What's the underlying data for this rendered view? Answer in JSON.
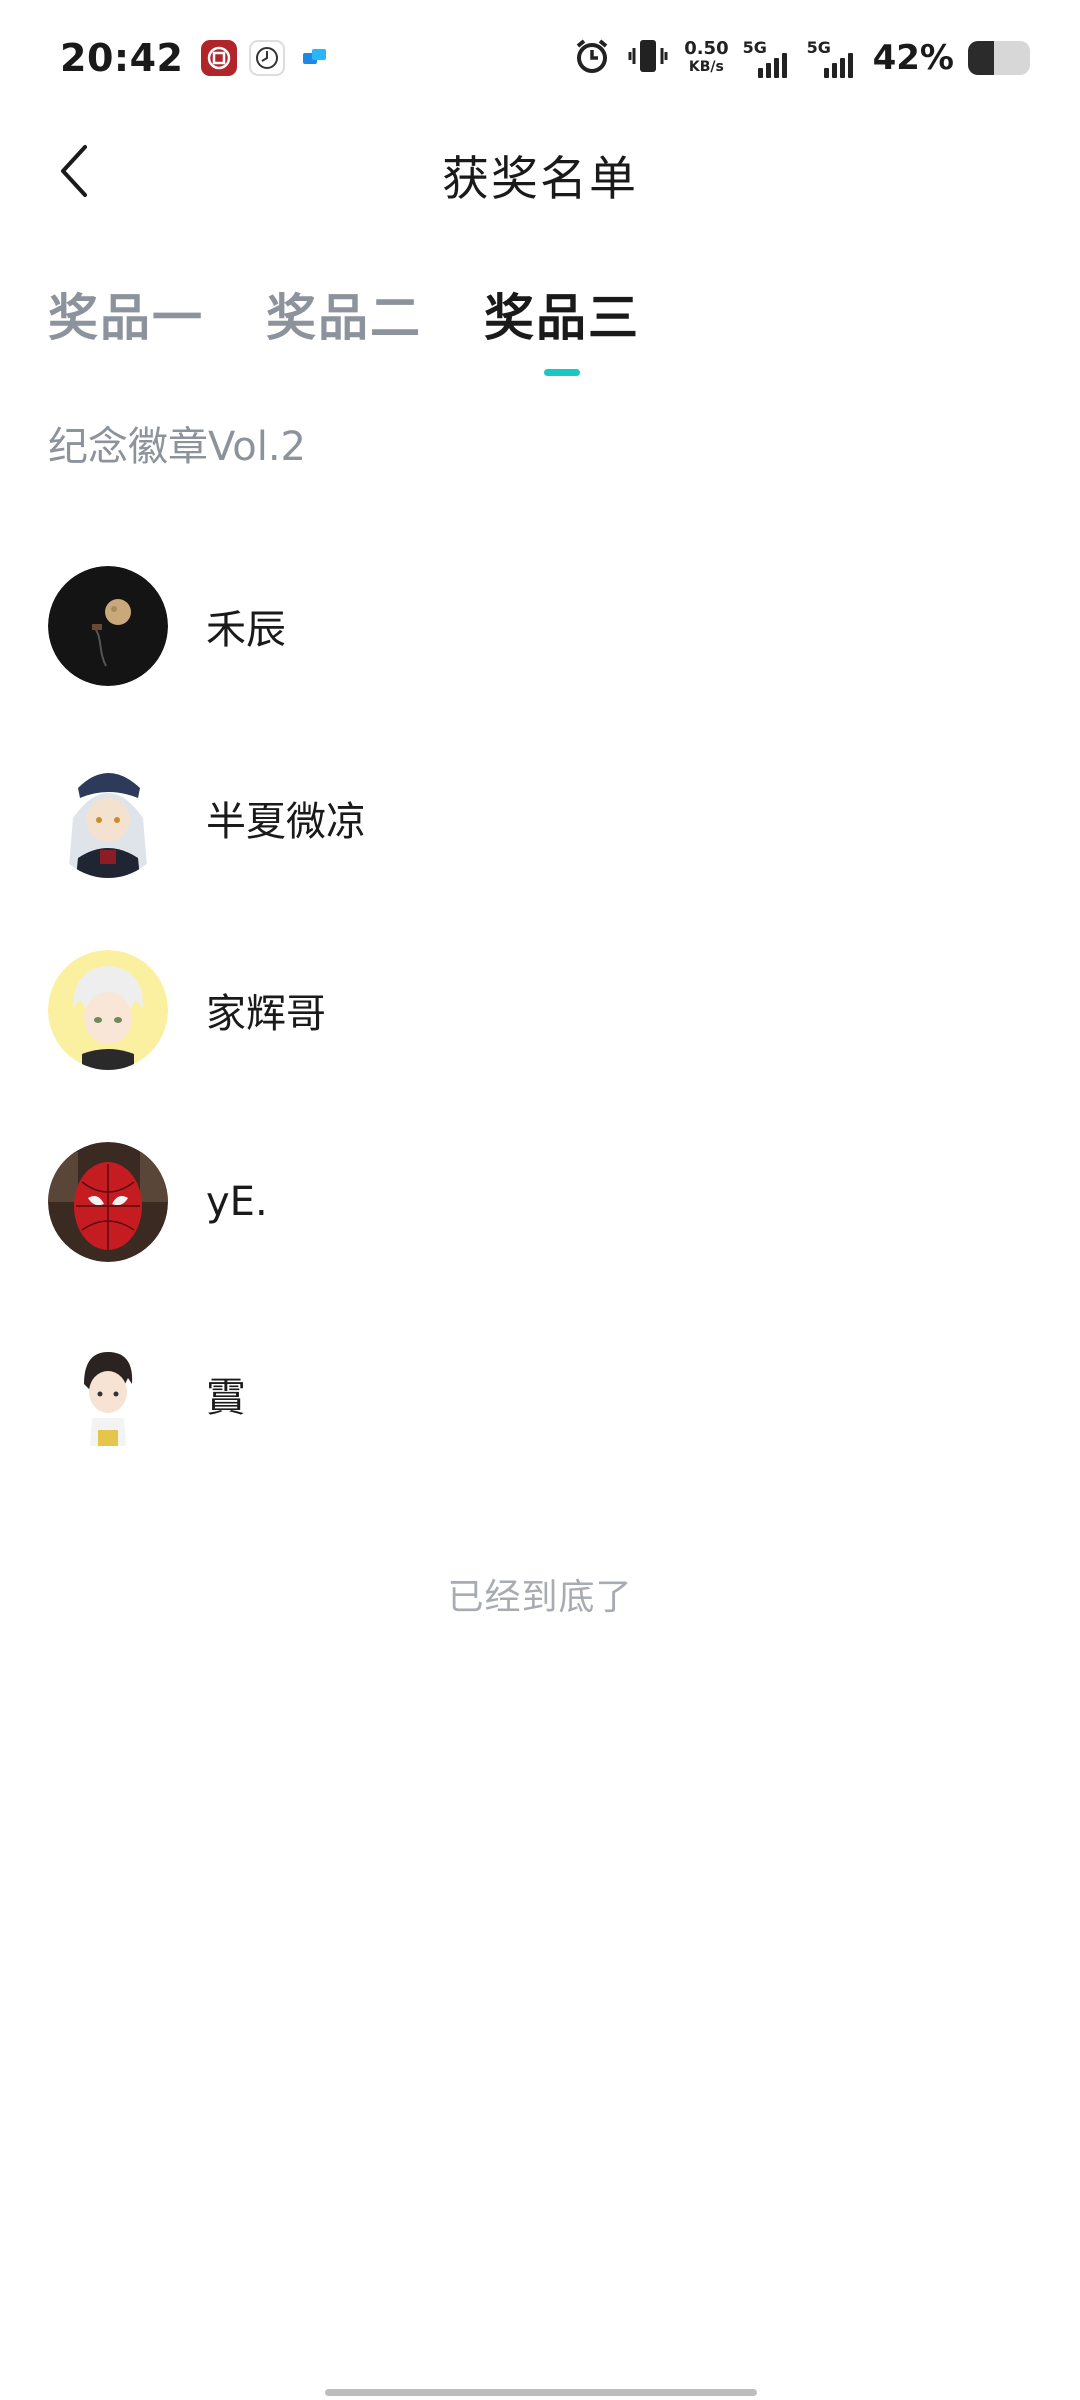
{
  "status_bar": {
    "time": "20:42",
    "notifications": [
      "bank-app-icon",
      "clock-app-icon",
      "chat-app-icon"
    ],
    "net_speed_value": "0.50",
    "net_speed_unit": "KB/s",
    "signal1_label": "5G",
    "signal2_label": "5G",
    "battery_percent": "42%",
    "battery_level": 0.42
  },
  "header": {
    "title": "获奖名单"
  },
  "tabs": [
    {
      "label": "奖品一",
      "active": false
    },
    {
      "label": "奖品二",
      "active": false
    },
    {
      "label": "奖品三",
      "active": true
    }
  ],
  "colors": {
    "accent": "#17c9c0",
    "inactive_text": "#8d939c",
    "primary_text": "#1a1a1a"
  },
  "prize_name": "纪念徽章Vol.2",
  "winners": [
    {
      "name": "禾辰",
      "avatar": "moon-dark-avatar"
    },
    {
      "name": "半夏微凉",
      "avatar": "anime-girl-avatar"
    },
    {
      "name": "家辉哥",
      "avatar": "anime-boy-yellow-avatar"
    },
    {
      "name": "yE.",
      "avatar": "spiderman-avatar"
    },
    {
      "name": "霣",
      "avatar": "anime-boy-avatar"
    }
  ],
  "end_text": "已经到底了"
}
